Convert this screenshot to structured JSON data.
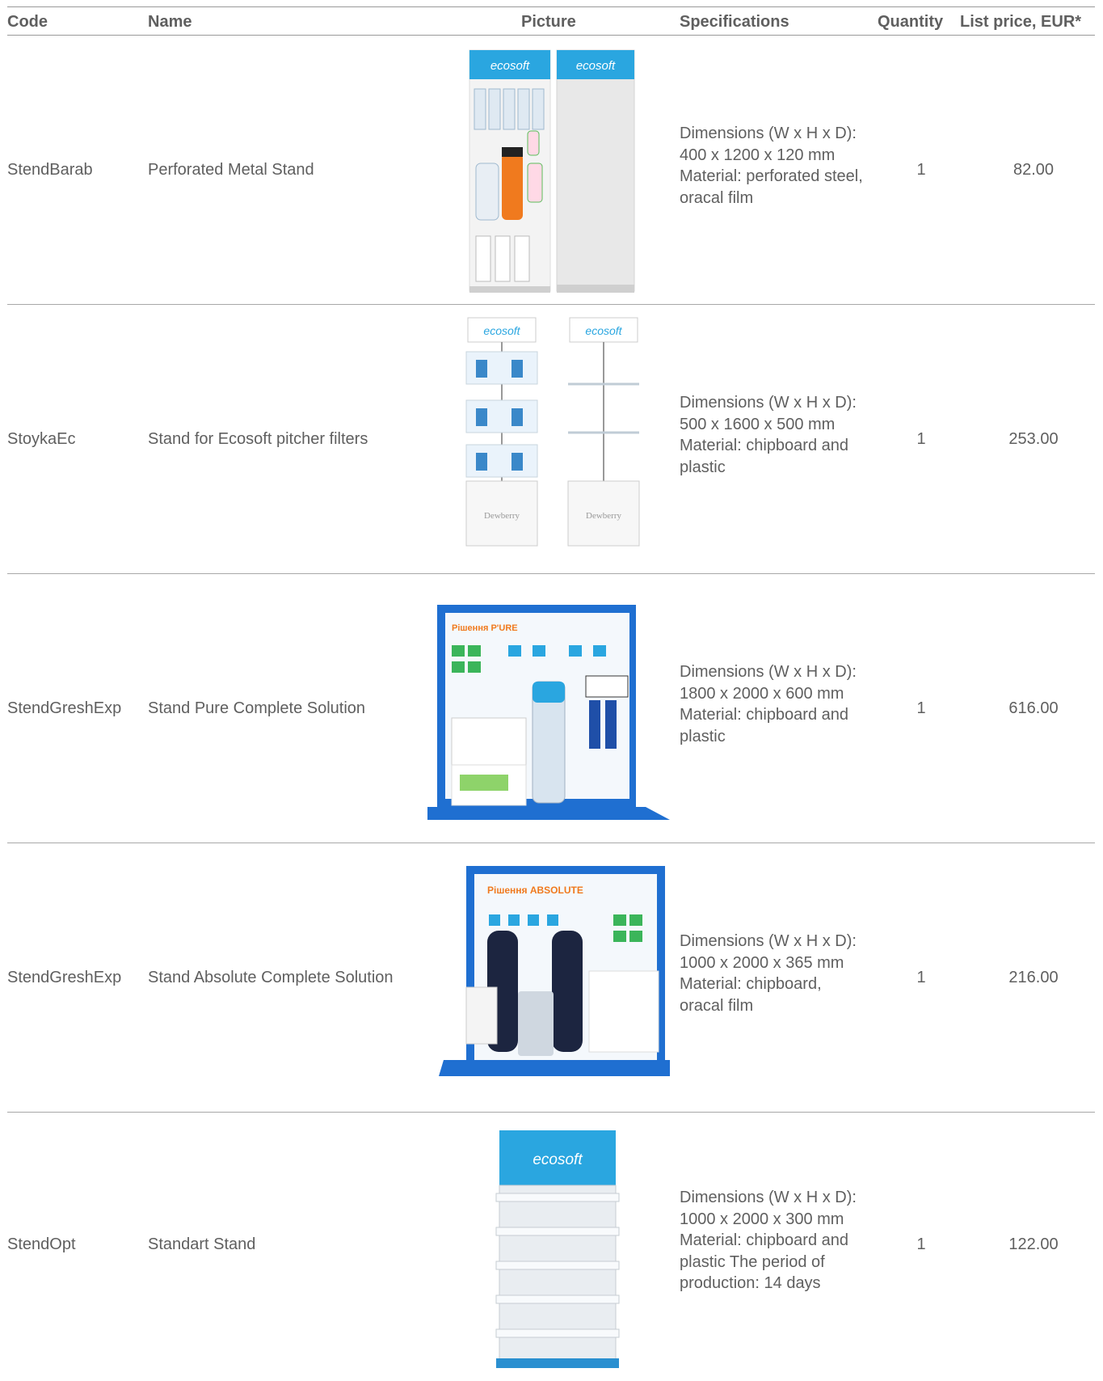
{
  "headers": {
    "code": "Code",
    "name": "Name",
    "picture": "Picture",
    "specifications": "Specifications",
    "quantity": "Quantity",
    "list_price": "List price, EUR*"
  },
  "brand": {
    "logo_text": "ecosoft",
    "accent_color": "#2aa6e0",
    "stand_blue": "#1f6fd1"
  },
  "rows": [
    {
      "code": "StendBarab",
      "name": "Perforated Metal Stand",
      "specs": [
        "Dimensions (W x H x D):",
        "400 x 1200 x 120 mm",
        "Material: perforated steel,",
        "oracal film"
      ],
      "quantity": "1",
      "price": "82.00"
    },
    {
      "code": "StoykaEc",
      "name": "Stand for Ecosoft pitcher filters",
      "specs": [
        "Dimensions (W x H x D):",
        "500 x 1600 x 500 mm",
        "Material: chipboard and",
        "plastic"
      ],
      "quantity": "1",
      "price": "253.00",
      "picture_label": "Dewberry"
    },
    {
      "code": "StendGreshExp",
      "name": "Stand Pure Complete Solution",
      "specs": [
        "Dimensions (W x H x D):",
        "1800 x 2000 x 600 mm",
        "Material: chipboard and",
        "plastic"
      ],
      "quantity": "1",
      "price": "616.00",
      "picture_label": "Рішення P'URE"
    },
    {
      "code": "StendGreshExp",
      "name": "Stand Absolute Complete Solution",
      "specs": [
        "Dimensions (W x H x D):",
        "1000 x 2000 x 365 mm",
        "Material: chipboard,",
        "oracal film"
      ],
      "quantity": "1",
      "price": "216.00",
      "picture_label": "Рішення ABSOLUTE"
    },
    {
      "code": "StendOpt",
      "name": "Standart Stand",
      "specs": [
        "Dimensions (W x H x D):",
        "1000 x 2000 x 300 mm",
        "Material: chipboard and",
        "plastic The period of",
        "production: 14 days"
      ],
      "quantity": "1",
      "price": "122.00"
    }
  ]
}
